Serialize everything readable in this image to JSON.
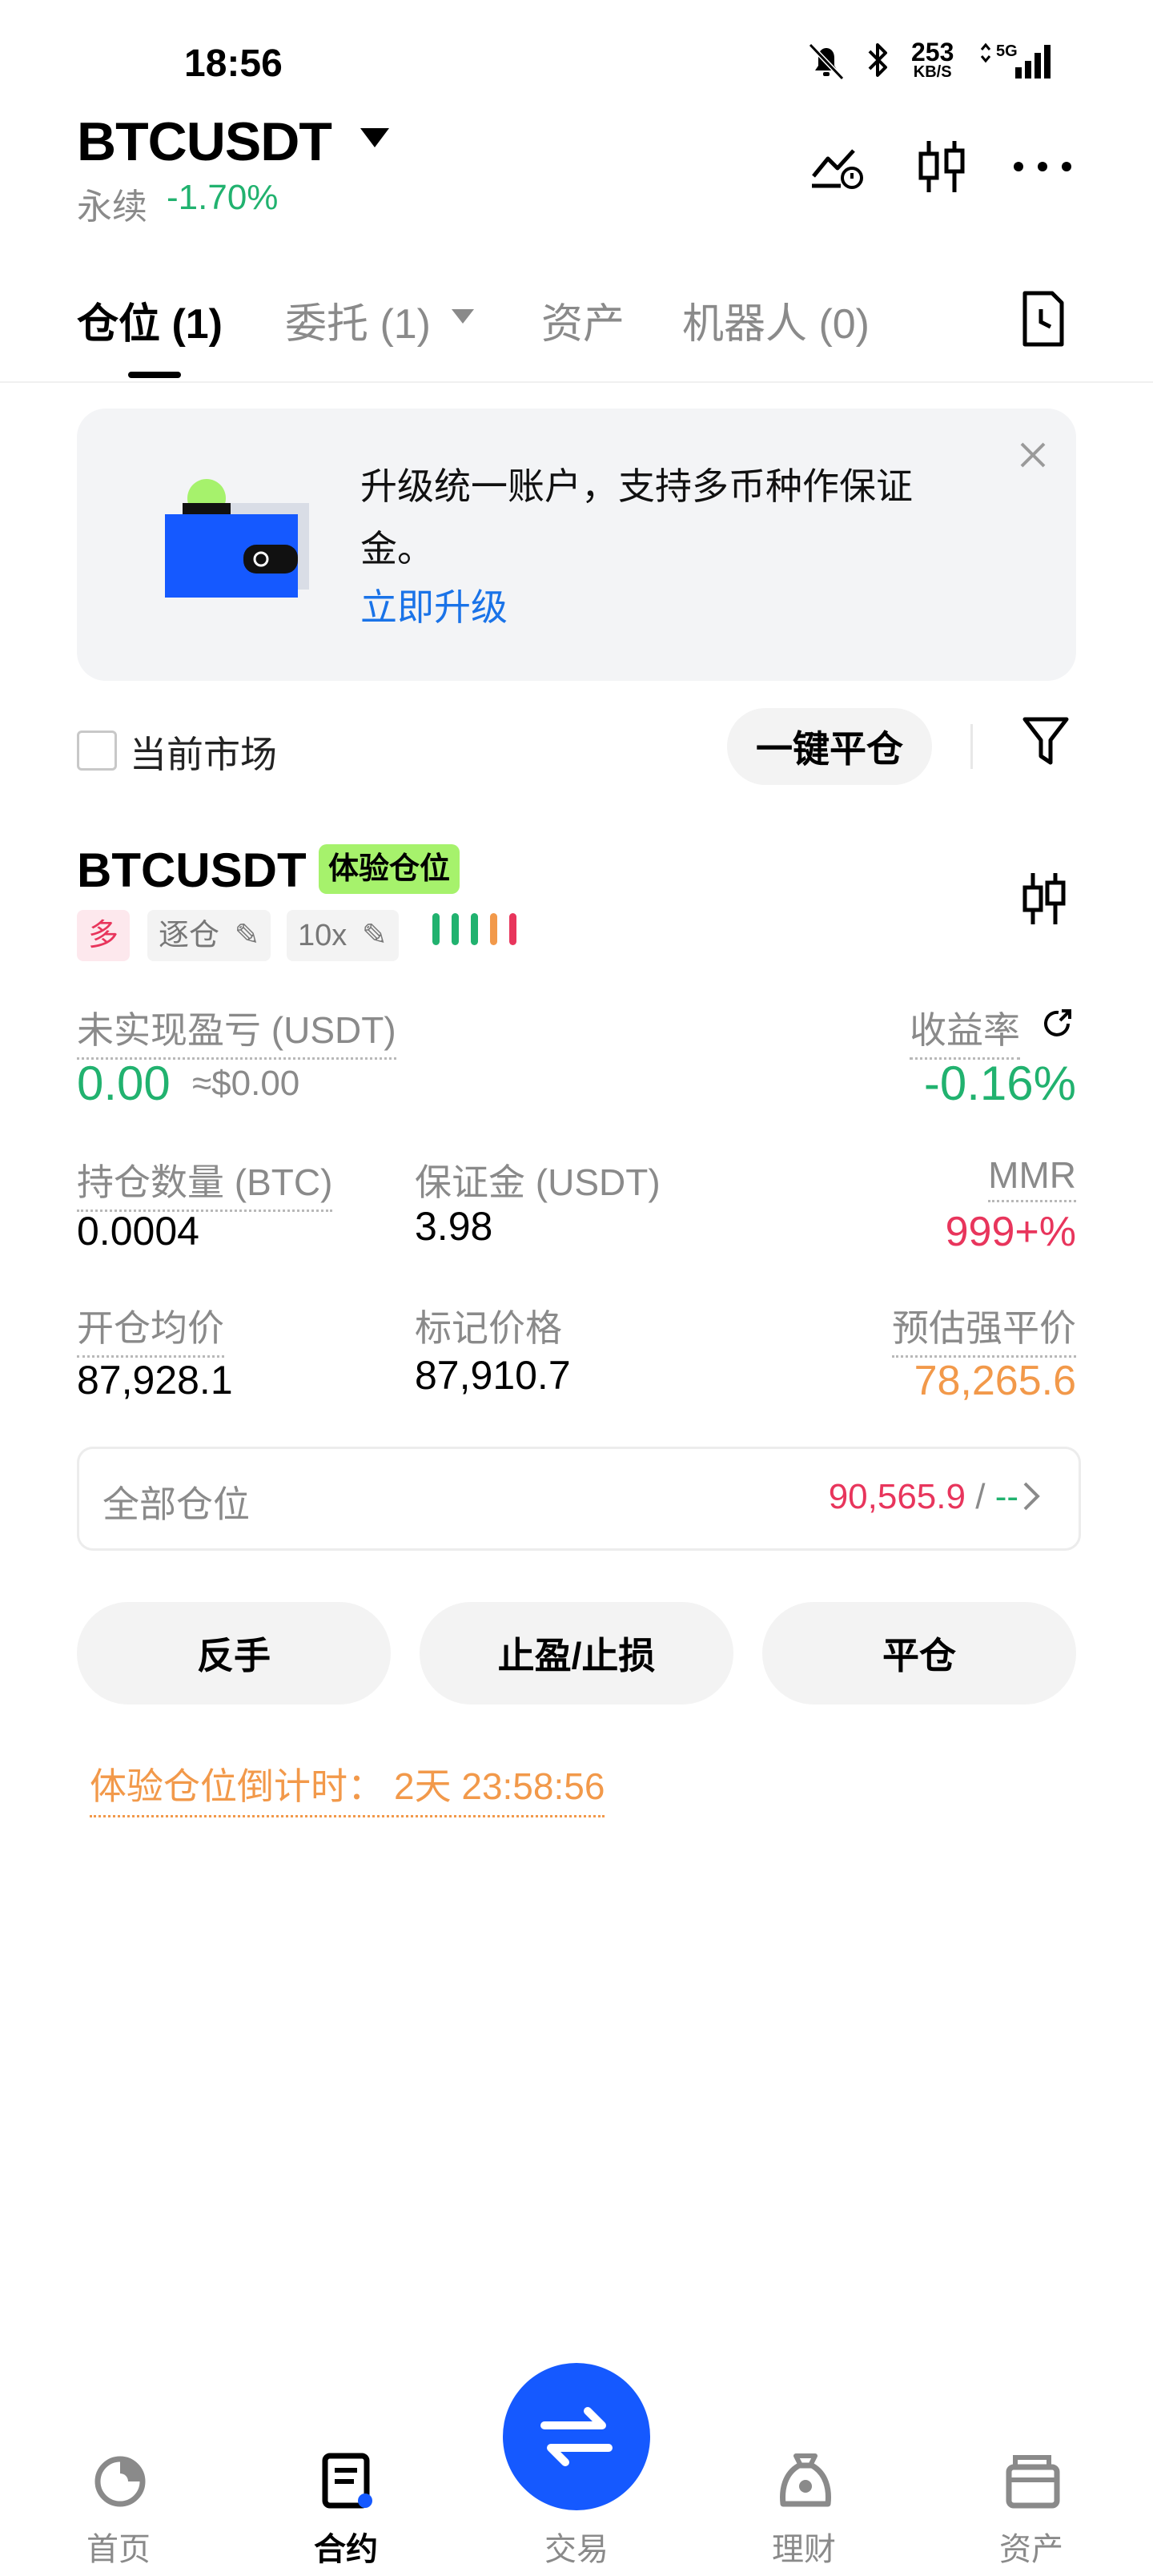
{
  "status_bar": {
    "time": "18:56",
    "net_speed_value": "253",
    "net_speed_unit": "KB/S",
    "network": "5G"
  },
  "header": {
    "symbol": "BTCUSDT",
    "contract_type": "永续",
    "change": "-1.70%"
  },
  "tabs": [
    {
      "label": "仓位 (1)",
      "active": true
    },
    {
      "label": "委托 (1)",
      "active": false
    },
    {
      "label": "资产",
      "active": false
    },
    {
      "label": "机器人 (0)",
      "active": false
    }
  ],
  "banner": {
    "text": "升级统一账户，支持多币种作保证金。",
    "link": "立即升级"
  },
  "filter": {
    "checkbox_label": "当前市场",
    "close_all": "一键平仓"
  },
  "position": {
    "symbol": "BTCUSDT",
    "badge": "体验仓位",
    "side": "多",
    "margin_mode": "逐仓",
    "leverage": "10x",
    "pnl_label": "未实现盈亏 (USDT)",
    "pnl_value": "0.00",
    "pnl_usd": "≈$0.00",
    "roe_label": "收益率",
    "roe_value": "-0.16%",
    "size_label": "持仓数量 (BTC)",
    "size_value": "0.0004",
    "margin_label": "保证金 (USDT)",
    "margin_value": "3.98",
    "mmr_label": "MMR",
    "mmr_value": "999+%",
    "entry_label": "开仓均价",
    "entry_value": "87,928.1",
    "mark_label": "标记价格",
    "mark_value": "87,910.7",
    "liq_label": "预估强平价",
    "liq_value": "78,265.6",
    "all_positions_label": "全部仓位",
    "all_positions_value": "90,565.9",
    "all_positions_sep": "/",
    "all_positions_alt": "--",
    "actions": [
      "反手",
      "止盈/止损",
      "平仓"
    ],
    "countdown_label": "体验仓位倒计时：",
    "countdown_value": "2天 23:58:56"
  },
  "nav": [
    {
      "label": "首页",
      "icon": "home-icon",
      "active": false
    },
    {
      "label": "合约",
      "icon": "contract-icon",
      "active": true
    },
    {
      "label": "交易",
      "icon": "swap-icon",
      "active": false
    },
    {
      "label": "理财",
      "icon": "finance-icon",
      "active": false
    },
    {
      "label": "资产",
      "icon": "wallet-icon",
      "active": false
    }
  ],
  "colors": {
    "green": "#21b26f",
    "red": "#e8355c",
    "orange": "#f2994a",
    "blue": "#1a73e8",
    "fab": "#1559ff",
    "badge": "#a6f26c"
  }
}
